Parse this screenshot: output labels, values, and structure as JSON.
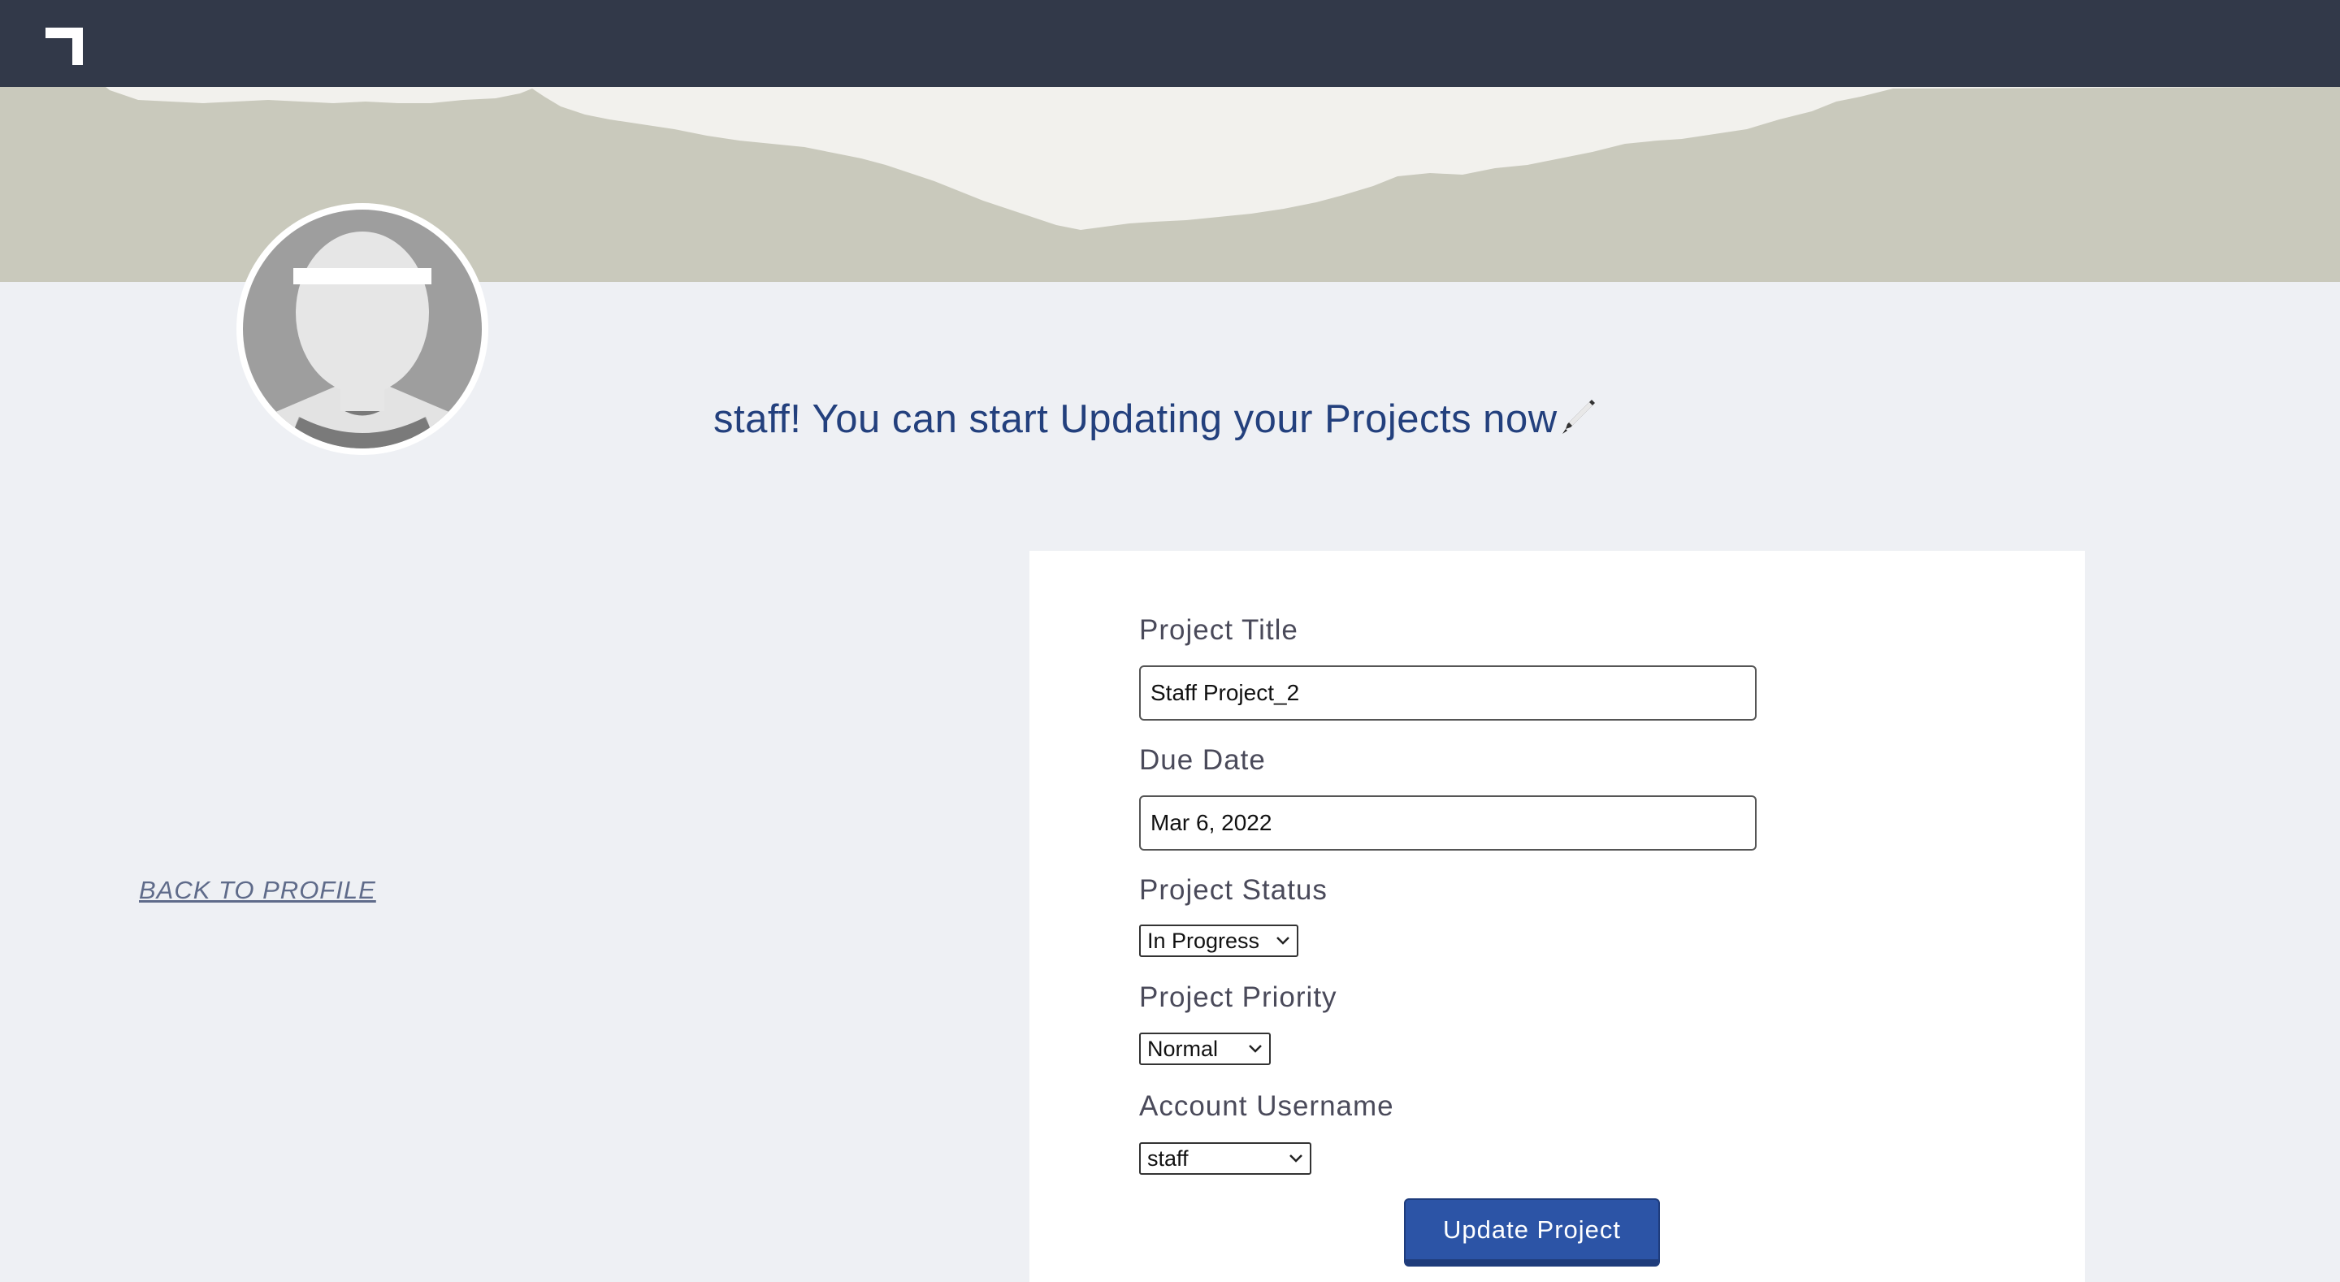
{
  "header": {
    "logo_icon": "corner-bracket-logo-icon"
  },
  "profile": {
    "avatar_icon": "user-silhouette-icon"
  },
  "headline": {
    "text": "staff! You can start Updating your Projects now",
    "icon": "pen-icon"
  },
  "nav": {
    "back_to_profile": "BACK TO PROFILE"
  },
  "form": {
    "project_title": {
      "label": "Project Title",
      "value": "Staff Project_2"
    },
    "due_date": {
      "label": "Due Date",
      "value": "Mar 6, 2022"
    },
    "project_status": {
      "label": "Project Status",
      "value": "In Progress"
    },
    "project_priority": {
      "label": "Project Priority",
      "value": "Normal"
    },
    "account_username": {
      "label": "Account Username",
      "value": "staff"
    },
    "submit_label": "Update Project"
  },
  "colors": {
    "topbar": "#323949",
    "banner": "#c9c9bc",
    "page_bg": "#eef0f4",
    "headline": "#23407d",
    "button": "#2c54a6"
  }
}
